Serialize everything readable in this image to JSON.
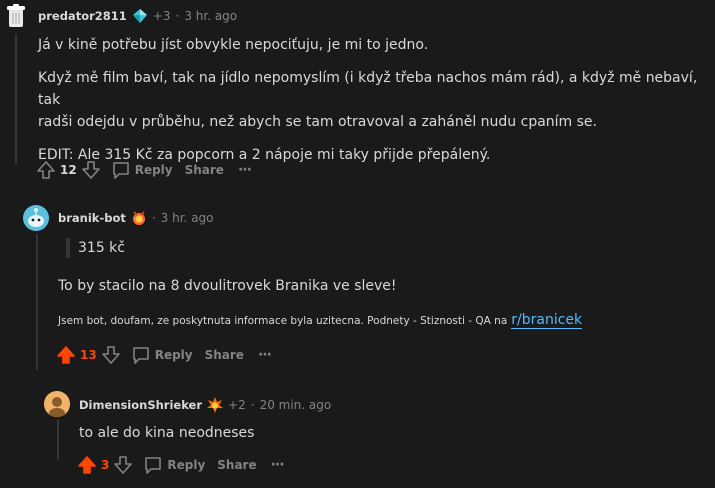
{
  "comments": [
    {
      "username": "predator2811",
      "flair_icon": "diamond-icon",
      "karma": "+3",
      "separator": "·",
      "time": "3 hr. ago",
      "paragraphs": [
        "Já v kině potřebu jíst obvykle nepociťuju, je mi to jedno.",
        "Když mě film baví, tak na jídlo nepomyslím (i když třeba nachos mám rád), a když mě nebaví, tak",
        "radši odejdu v průběhu, než abych se tam otravoval a zaháněl nudu cpaním se.",
        "EDIT: Ale 315 Kč za popcorn a 2 nápoje mi taky přijde přepálený."
      ],
      "votes": "12",
      "reply_label": "Reply",
      "share_label": "Share",
      "more_label": "···"
    },
    {
      "username": "branik-bot",
      "flair_icon": "medal-icon",
      "separator": "·",
      "time": "3 hr. ago",
      "quote": "315 kč",
      "paragraph": "To by stacilo na 8 dvoulitrovek Branika ve sleve!",
      "footer_text": "Jsem bot, doufam, ze poskytnuta informace byla uzitecna. Podnety - Stiznosti - QA na",
      "footer_link": "r/branicek",
      "votes": "13",
      "reply_label": "Reply",
      "share_label": "Share",
      "more_label": "···"
    },
    {
      "username": "DimensionShrieker",
      "flair_icon": "explosion-icon",
      "karma": "+2",
      "separator": "·",
      "time": "20 min. ago",
      "paragraph": "to ale do kina neodneses",
      "votes": "3",
      "reply_label": "Reply",
      "share_label": "Share",
      "more_label": "···"
    }
  ],
  "colors": {
    "background": "#1a1a1b",
    "text": "#d7dadc",
    "muted": "#818384",
    "upvote": "#ff4500",
    "link": "#4fbcff",
    "thread_line": "#343536"
  }
}
